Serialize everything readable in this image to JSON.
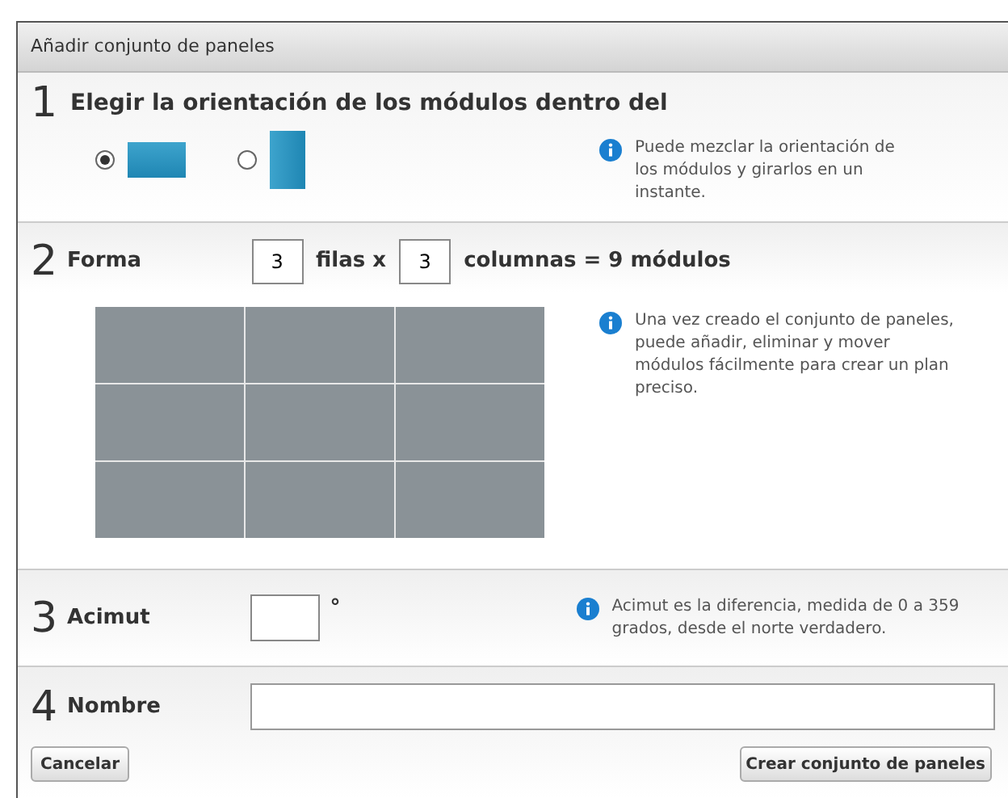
{
  "dialog": {
    "title": "Añadir conjunto de paneles"
  },
  "step1": {
    "number": "1",
    "title": "Elegir la orientación de los módulos dentro del",
    "options": [
      {
        "kind": "landscape",
        "selected": true
      },
      {
        "kind": "portrait",
        "selected": false
      }
    ],
    "info": "Puede mezclar la orientación de los módulos y girarlos en un instante."
  },
  "step2": {
    "number": "2",
    "label": "Forma",
    "rows": "3",
    "rows_label": "filas x",
    "columns": "3",
    "columns_label": "columnas = 9 módulos",
    "info": "Una vez creado el conjunto de paneles, puede añadir, eliminar y mover módulos fácilmente para crear un plan preciso."
  },
  "step3": {
    "number": "3",
    "label": "Acimut",
    "unit": "°",
    "info": "Acimut es la diferencia, medida de 0 a 359 grados, desde el norte verdadero."
  },
  "step4": {
    "number": "4",
    "label": "Nombre"
  },
  "buttons": {
    "cancel": "Cancelar",
    "create": "Crear conjunto de paneles"
  }
}
